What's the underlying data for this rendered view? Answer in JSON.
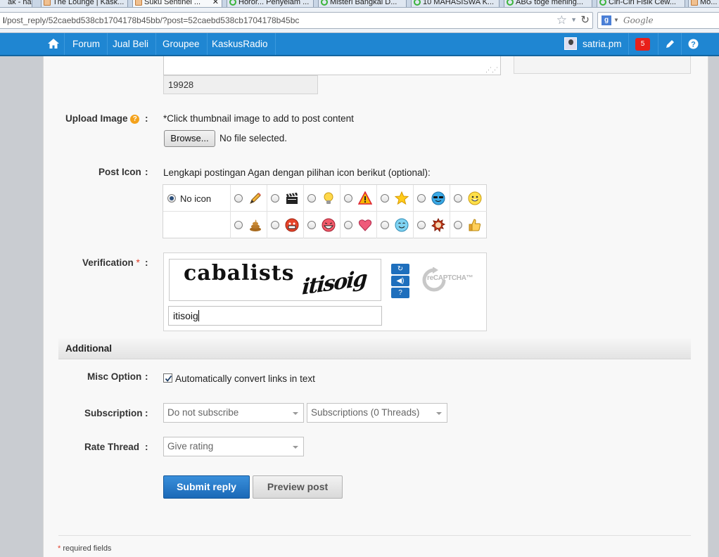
{
  "browser": {
    "tabs": [
      {
        "title": "ak - ha..."
      },
      {
        "title": "The Lounge | Kask..."
      },
      {
        "title": "Suku Sentinel ..."
      },
      {
        "title": "Horor... Penyelam ..."
      },
      {
        "title": "Misteri Bangkai D..."
      },
      {
        "title": "10 MAHASISWA K..."
      },
      {
        "title": "ABG toge mening..."
      },
      {
        "title": "Ciri-Ciri Fisik Cew..."
      },
      {
        "title": "Mo..."
      }
    ],
    "url_prefix": "l",
    "url_path": "/post_reply/52caebd538cb1704178b45bb/?post=52caebd538cb1704178b45bc",
    "search_placeholder": "Google",
    "search_engine_letter": "g"
  },
  "nav": {
    "links": [
      "Forum",
      "Jual Beli",
      "Groupee",
      "KaskusRadio"
    ],
    "username": "satria.pm",
    "notification_count": "5"
  },
  "form": {
    "char_count": "19928",
    "upload": {
      "label": "Upload Image",
      "hint": "*Click thumbnail image to add to post content",
      "browse_label": "Browse...",
      "file_status": "No file selected."
    },
    "post_icon": {
      "label": "Post Icon",
      "prompt": "Lengkapi postingan Agan dengan pilihan icon berikut (optional):",
      "no_icon_label": "No icon",
      "selected": "No icon"
    },
    "verification": {
      "label": "Verification",
      "required_mark": "*",
      "captcha_word1": "cabalists",
      "captcha_word2": "itisoig",
      "answer": "itisoig",
      "logo_text": "reCAPTCHA™"
    },
    "colon": ":"
  },
  "additional": {
    "title": "Additional",
    "misc_label": "Misc Option",
    "convert_links_label": "Automatically convert links in text",
    "convert_links_checked": true,
    "subscription_label": "Subscription",
    "subscription_value": "Do not subscribe",
    "subscriptions_threads": "Subscriptions (0 Threads)",
    "rate_label": "Rate Thread",
    "rate_value": "Give rating"
  },
  "actions": {
    "submit_label": "Submit reply",
    "preview_label": "Preview post"
  },
  "footer": {
    "required_mark": "*",
    "required_note": " required fields"
  }
}
